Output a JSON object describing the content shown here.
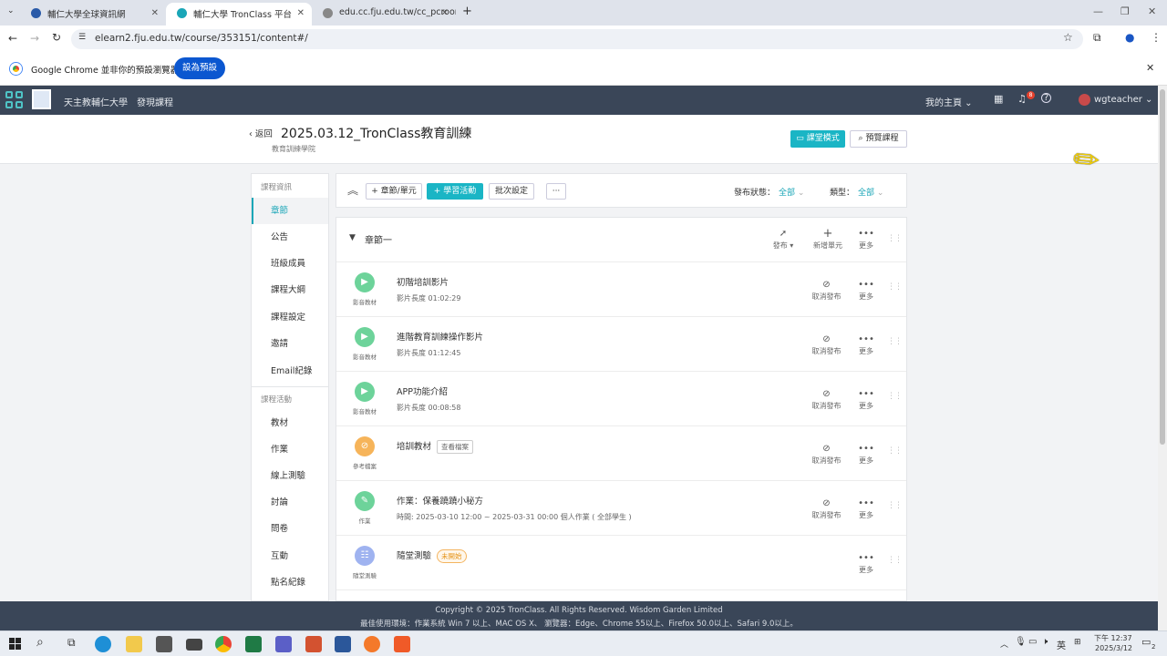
{
  "browser": {
    "tabs": [
      {
        "label": "輔仁大學全球資訊網"
      },
      {
        "label": "輔仁大學 TronClass 平台"
      },
      {
        "label": "edu.cc.fju.edu.tw/cc_pcroom/"
      }
    ],
    "url": "elearn2.fju.edu.tw/course/353151/content#/",
    "infobar_text": "Google Chrome 並非你的預設瀏覽器",
    "infobar_button": "設為預設"
  },
  "appnav": {
    "university": "天主教輔仁大學",
    "discover": "發現課程",
    "home_menu": "我的主頁",
    "notification_count": "8",
    "username": "wgteacher"
  },
  "course": {
    "back_label": "返回",
    "title": "2025.03.12_TronClass教育訓練",
    "department": "教育訓練學院",
    "classroom_mode": "課堂模式",
    "preview": "預覽課程"
  },
  "sidebar": {
    "section1": "課程資訊",
    "items1": [
      "章節",
      "公告",
      "班級成員",
      "課程大綱",
      "課程設定",
      "邀請",
      "Email紀錄"
    ],
    "section2": "課程活動",
    "items2": [
      "教材",
      "作業",
      "線上測驗",
      "討論",
      "問卷",
      "互動",
      "點名紀錄"
    ]
  },
  "toolbar": {
    "add_chapter": "+ 章節/單元",
    "add_activity": "+ 學習活動",
    "batch": "批次設定",
    "more": "···",
    "status_label": "發布狀態：",
    "status_value": "全部",
    "type_label": "類型：",
    "type_value": "全部"
  },
  "chapter": {
    "title": "章節一",
    "publish": "發布",
    "add_unit": "新增單元",
    "more": "更多"
  },
  "activities": [
    {
      "type": "影音教材",
      "title": "初階培訓影片",
      "sub": "影片長度  01:02:29",
      "tag": "",
      "unpublish": "取消發布",
      "more": "更多",
      "color": "#6dd39a",
      "icon": "▶"
    },
    {
      "type": "影音教材",
      "title": "進階教育訓練操作影片",
      "sub": "影片長度  01:12:45",
      "tag": "",
      "unpublish": "取消發布",
      "more": "更多",
      "color": "#6dd39a",
      "icon": "▶"
    },
    {
      "type": "影音教材",
      "title": "APP功能介紹",
      "sub": "影片長度  00:08:58",
      "tag": "",
      "unpublish": "取消發布",
      "more": "更多",
      "color": "#6dd39a",
      "icon": "▶"
    },
    {
      "type": "參考檔案",
      "title": "培訓教材",
      "sub": "",
      "tag": "查看檔案",
      "unpublish": "取消發布",
      "more": "更多",
      "color": "#f6b45a",
      "icon": "⊘"
    },
    {
      "type": "作業",
      "title": "作業：保養蹺蹺小秘方",
      "sub": "時間: 2025-03-10 12:00 ~ 2025-03-31 00:00  個人作業 ( 全部學生 )",
      "tag": "",
      "unpublish": "取消發布",
      "more": "更多",
      "color": "#6dd39a",
      "icon": "✎"
    },
    {
      "type": "隨堂測驗",
      "title": "隨堂測驗",
      "sub": "",
      "tag": "未開始",
      "unpublish": "",
      "more": "更多",
      "color": "#9fb3f0",
      "icon": "☷"
    }
  ],
  "footer": {
    "copyright": "Copyright © 2025 TronClass. All Rights Reserved. Wisdom Garden Limited",
    "env": "最佳使用環境：作業系統 Win 7 以上、MAC OS X、 瀏覽器：Edge、Chrome 55以上、Firefox 50.0以上、Safari 9.0以上。"
  },
  "taskbar": {
    "lang": "英",
    "time": "下午 12:37",
    "date": "2025/3/12",
    "notif": "2"
  }
}
